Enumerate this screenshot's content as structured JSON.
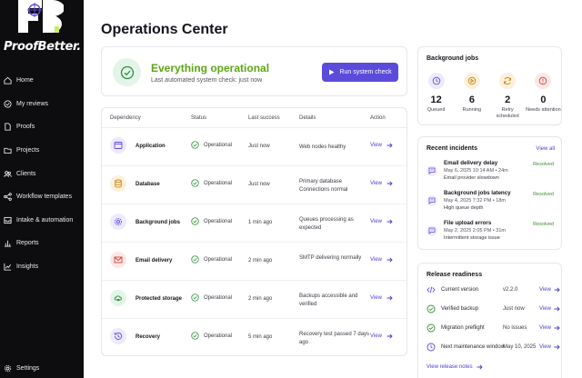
{
  "brand": {
    "name": "ProofBetter."
  },
  "sidebar": {
    "items": [
      {
        "label": "Home",
        "icon": "home-icon"
      },
      {
        "label": "My reviews",
        "icon": "check-circle-icon"
      },
      {
        "label": "Proofs",
        "icon": "document-icon"
      },
      {
        "label": "Projects",
        "icon": "folder-icon"
      },
      {
        "label": "Clients",
        "icon": "users-icon"
      },
      {
        "label": "Workflow templates",
        "icon": "workflow-icon"
      },
      {
        "label": "Intake & automation",
        "icon": "inbox-icon"
      },
      {
        "label": "Reports",
        "icon": "bar-chart-icon"
      },
      {
        "label": "Insights",
        "icon": "line-chart-icon"
      }
    ],
    "settings_label": "Settings"
  },
  "page": {
    "title": "Operations Center"
  },
  "status": {
    "title": "Everything operational",
    "subtitle": "Last automated system check: just now",
    "run_button": "Run system check"
  },
  "dependencies": {
    "headers": {
      "dependency": "Dependency",
      "status": "Status",
      "last_success": "Last success",
      "details": "Details",
      "action": "Action"
    },
    "rows": [
      {
        "name": "Application",
        "status": "Operational",
        "last": "Just now",
        "details": "Web nodes healthy",
        "action": "View"
      },
      {
        "name": "Database",
        "status": "Operational",
        "last": "Just now",
        "details": "Primary database Connections normal",
        "action": "View"
      },
      {
        "name": "Background jobs",
        "status": "Operational",
        "last": "1 min ago",
        "details": "Queues processing as expected",
        "action": "View"
      },
      {
        "name": "Email delivery",
        "status": "Operational",
        "last": "2 min ago",
        "details": "SMTP delivering normally",
        "action": "View"
      },
      {
        "name": "Protected storage",
        "status": "Operational",
        "last": "2 min ago",
        "details": "Backups accessible and verified",
        "action": "View"
      },
      {
        "name": "Recovery",
        "status": "Operational",
        "last": "5 min ago",
        "details": "Recovery test passed 7 days ago",
        "action": "View"
      }
    ]
  },
  "background_jobs": {
    "title": "Background jobs",
    "items": [
      {
        "count": "12",
        "label": "Queued"
      },
      {
        "count": "6",
        "label": "Running"
      },
      {
        "count": "2",
        "label": "Retry scheduled"
      },
      {
        "count": "0",
        "label": "Needs attention"
      }
    ]
  },
  "incidents": {
    "title": "Recent incidents",
    "view_all": "View all",
    "items": [
      {
        "title": "Email delivery delay",
        "meta": "May 6, 2025 10:14 AM • 24m",
        "desc": "Email provider slowdown",
        "status": "Resolved"
      },
      {
        "title": "Background jobs latency",
        "meta": "May 4, 2025 7:32 PM • 18m",
        "desc": "High queue depth",
        "status": "Resolved"
      },
      {
        "title": "File upload errors",
        "meta": "May 2, 2025 2:05 PM • 31m",
        "desc": "Intermittent storage issue",
        "status": "Resolved"
      }
    ]
  },
  "release": {
    "title": "Release readiness",
    "rows": [
      {
        "label": "Current version",
        "value": "v2.2.0",
        "action": "View"
      },
      {
        "label": "Verified backup",
        "value": "Just now",
        "action": "View"
      },
      {
        "label": "Migration preflight",
        "value": "No issues",
        "action": "View"
      },
      {
        "label": "Next maintenance window",
        "value": "May 10, 2025",
        "action": "View"
      }
    ],
    "notes_link": "View release notes"
  },
  "colors": {
    "accent": "#5b4bdb",
    "success": "#5ea513",
    "sidebar_bg": "#0d0d10"
  }
}
